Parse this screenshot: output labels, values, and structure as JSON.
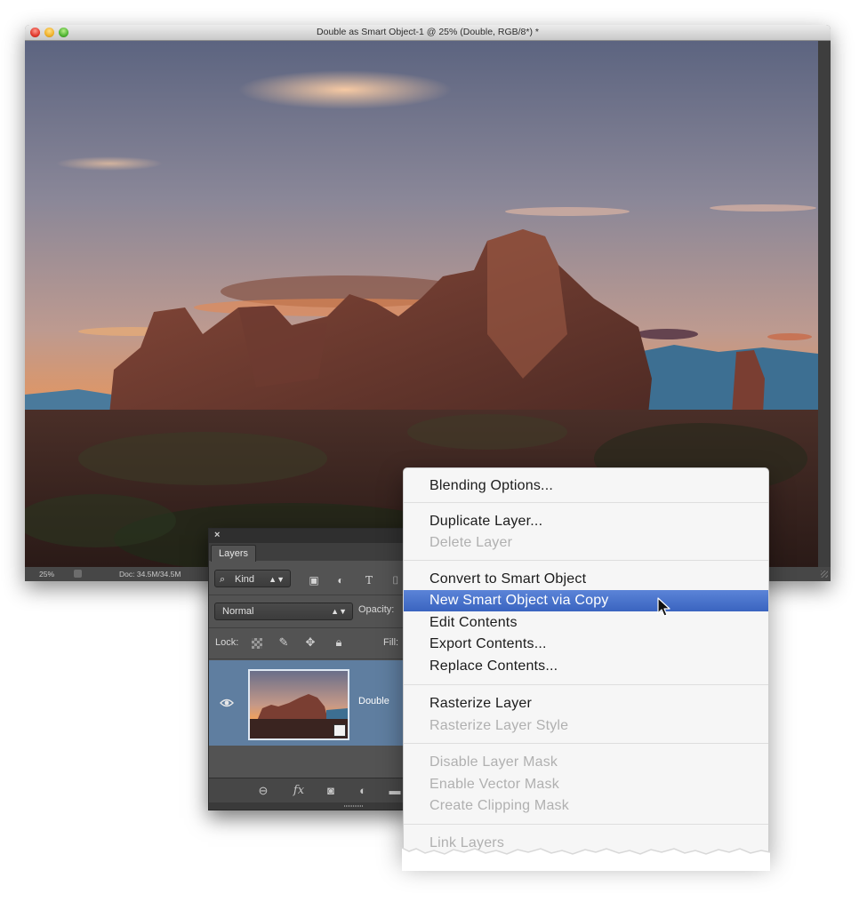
{
  "document_window": {
    "title": "Double as Smart Object-1 @ 25% (Double, RGB/8*) *",
    "status": {
      "zoom": "25%",
      "doc_size": "Doc: 34.5M/34.5M"
    }
  },
  "layers_panel": {
    "tab_label": "Layers",
    "kind_filter": "Kind",
    "filter_icons": [
      "image-filter-icon",
      "adjustment-filter-icon",
      "type-filter-icon",
      "shape-filter-icon"
    ],
    "blend_mode": "Normal",
    "opacity_label": "Opacity:",
    "lock_label": "Lock:",
    "lock_icons": [
      "lock-transparency-icon",
      "lock-paint-icon",
      "lock-position-icon",
      "lock-all-icon"
    ],
    "fill_label": "Fill:",
    "layers": [
      {
        "name": "Double",
        "selected": true,
        "visible": true,
        "smart_object": true
      }
    ],
    "bottom_icons": [
      "link-icon",
      "fx-icon",
      "mask-icon",
      "adjustment-icon",
      "folder-icon"
    ]
  },
  "context_menu": {
    "groups": [
      [
        {
          "label": "Blending Options...",
          "enabled": true
        }
      ],
      [
        {
          "label": "Duplicate Layer...",
          "enabled": true
        },
        {
          "label": "Delete Layer",
          "enabled": false
        }
      ],
      [
        {
          "label": "Convert to Smart Object",
          "enabled": true
        },
        {
          "label": "New Smart Object via Copy",
          "enabled": true,
          "highlighted": true
        },
        {
          "label": "Edit Contents",
          "enabled": true
        },
        {
          "label": "Export Contents...",
          "enabled": true
        },
        {
          "label": "Replace Contents...",
          "enabled": true
        }
      ],
      [
        {
          "label": "Rasterize Layer",
          "enabled": true
        },
        {
          "label": "Rasterize Layer Style",
          "enabled": false
        }
      ],
      [
        {
          "label": "Disable Layer Mask",
          "enabled": false
        },
        {
          "label": "Enable Vector Mask",
          "enabled": false
        },
        {
          "label": "Create Clipping Mask",
          "enabled": false
        }
      ],
      [
        {
          "label": "Link Layers",
          "enabled": false
        }
      ]
    ]
  },
  "colors": {
    "menu_highlight": "#3a64c0",
    "layer_selected": "#5f7ea0",
    "panel_bg": "#535353"
  }
}
